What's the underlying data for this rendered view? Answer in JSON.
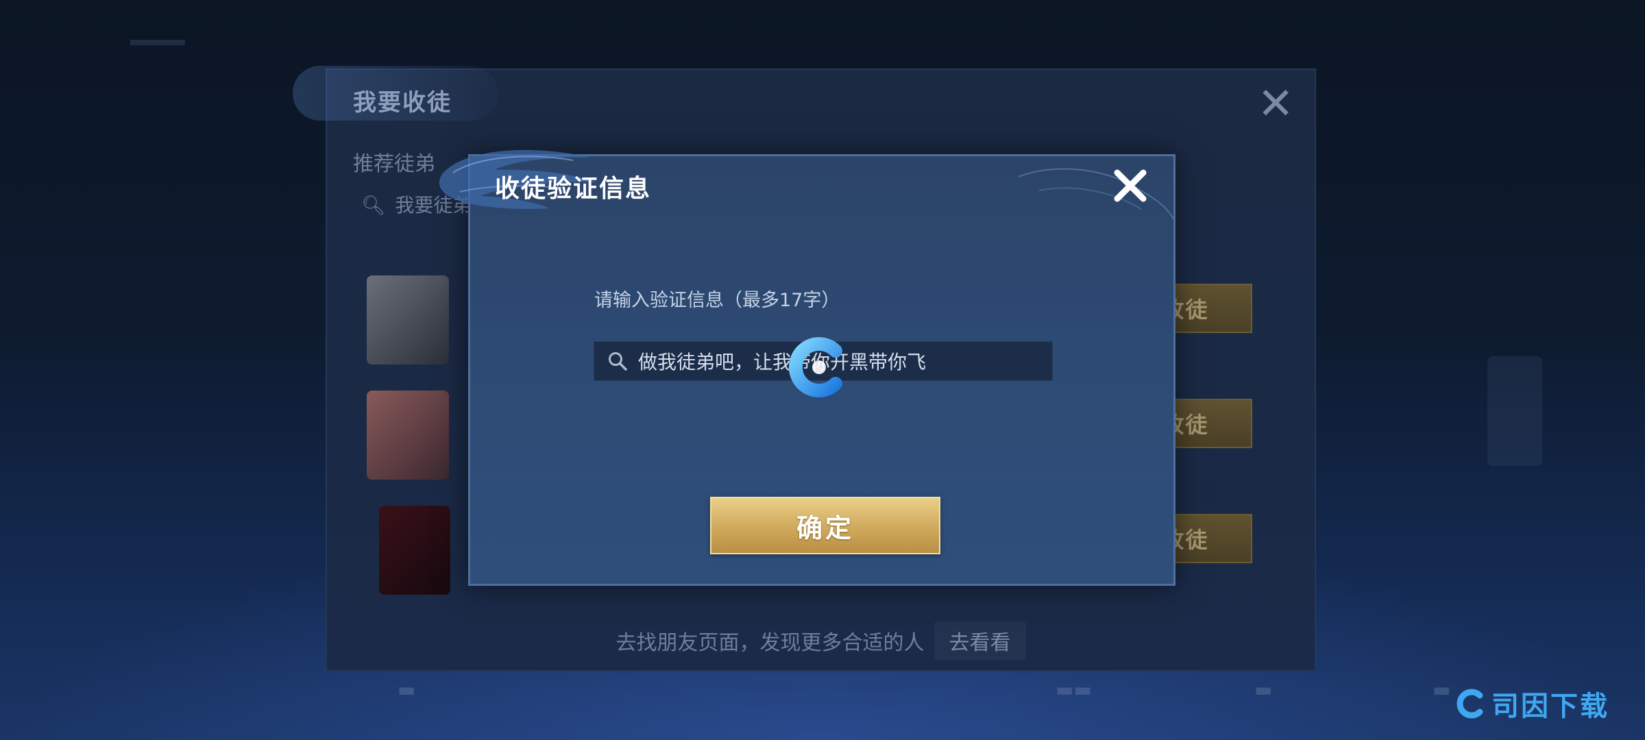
{
  "background_panel": {
    "title": "我要收徒",
    "subtitle": "推荐徒弟",
    "search_placeholder": "我要徒弟",
    "accept_label": "收徒",
    "footer_text": "去找朋友页面，发现更多合适的人",
    "footer_button": "去看看"
  },
  "dialog": {
    "title": "收徒验证信息",
    "prompt": "请输入验证信息（最多17字）",
    "input_value": "做我徒弟吧，让我带你开黑带你飞",
    "confirm_label": "确定"
  },
  "watermark": {
    "text": "司因下载"
  },
  "colors": {
    "dialog_bg": "#2d4a73",
    "confirm_gold": "#cfa95c",
    "watermark_blue": "#3fa8ef"
  },
  "icons": {
    "close": "close-x-icon",
    "search": "magnifier-icon",
    "logo": "c-logo-icon"
  }
}
